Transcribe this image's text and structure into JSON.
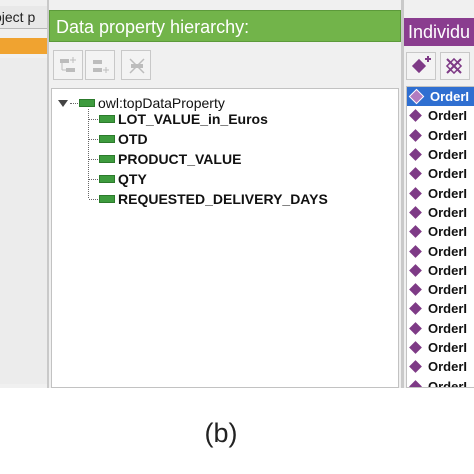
{
  "left_panel": {
    "tab_label": "oject p"
  },
  "data_property_panel": {
    "header_title": "Data property hierarchy:",
    "toolbar": {
      "add_subproperty": "add-subproperty-icon",
      "add_sibling": "add-sibling-property-icon",
      "delete": "delete-property-icon"
    },
    "tree": {
      "root": "owl:topDataProperty",
      "children": [
        "LOT_VALUE_in_Euros",
        "OTD",
        "PRODUCT_VALUE",
        "QTY",
        "REQUESTED_DELIVERY_DAYS"
      ]
    }
  },
  "individuals_panel": {
    "header_title": "Individu",
    "items": [
      "OrderI",
      "OrderI",
      "OrderI",
      "OrderI",
      "OrderI",
      "OrderI",
      "OrderI",
      "OrderI",
      "OrderI",
      "OrderI",
      "OrderI",
      "OrderI",
      "OrderI",
      "OrderI",
      "OrderI",
      "OrderI"
    ]
  },
  "caption": "(b)",
  "colors": {
    "data_property_green": "#72b44a",
    "individual_purple": "#8a3d8f",
    "selection_blue": "#2f6fd1",
    "left_orange": "#f0a330"
  }
}
